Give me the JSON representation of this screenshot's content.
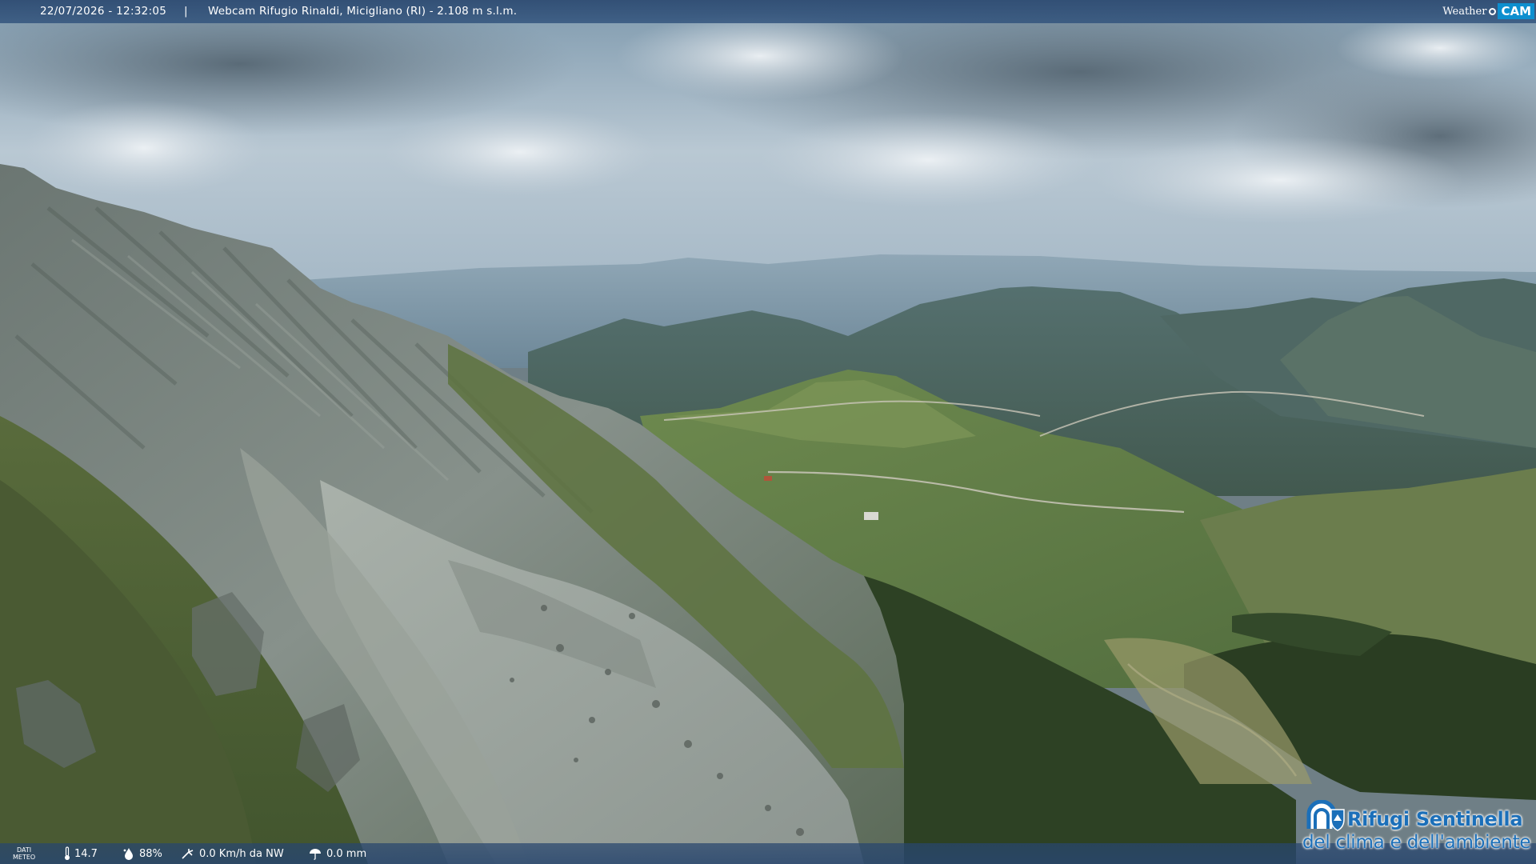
{
  "header": {
    "timestamp": "22/07/2026 - 12:32:05",
    "separator": "|",
    "title": "Webcam Rifugio Rinaldi, Micigliano (RI) - 2.108 m s.l.m.",
    "brand_weather": "Weather",
    "brand_cam": "CAM",
    "brand_color": "#0d8fcf"
  },
  "footer": {
    "dati_line1": "DATI",
    "dati_line2": "METEO",
    "temperature": "14.7",
    "humidity": "88%",
    "wind": "0.0 Km/h da NW",
    "rain": "0.0 mm",
    "icons": [
      "thermometer-icon",
      "humidity-icon",
      "wind-icon",
      "rain-icon"
    ]
  },
  "logo": {
    "line1": "Rifugi Sentinella",
    "line2": "del clima e dell'ambiente",
    "color": "#1b6fb9"
  }
}
